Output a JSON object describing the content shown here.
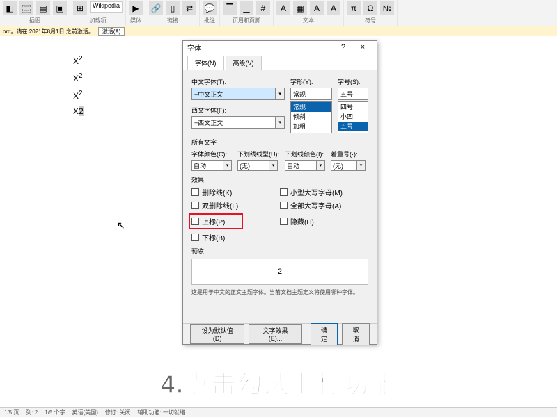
{
  "ribbon": {
    "groups": [
      {
        "label": "插图",
        "icons": [
          "3D 模",
          "SmartArt",
          "图表",
          "屏幕截图"
        ]
      },
      {
        "label": "加载项",
        "icons": [
          "获取加载项",
          "我的加载项",
          "Wikipedia"
        ]
      },
      {
        "label": "媒体",
        "icons": [
          "联机视频"
        ]
      },
      {
        "label": "链接",
        "icons": [
          "链接",
          "书签",
          "交叉引用"
        ]
      },
      {
        "label": "批注",
        "icons": [
          "批注"
        ]
      },
      {
        "label": "页眉和页脚",
        "icons": [
          "页眉",
          "页脚",
          "页码"
        ]
      },
      {
        "label": "文本",
        "icons": [
          "文本框",
          "文档部件",
          "艺术字",
          "首字下沉",
          "日期和时间",
          "对象"
        ]
      },
      {
        "label": "符号",
        "icons": [
          "公式",
          "符号",
          "编号"
        ]
      }
    ]
  },
  "messagebar": {
    "text": "ord。请在 2021年8月1日 之前激活。",
    "button": "激活(A)"
  },
  "document": {
    "lines": [
      "X²",
      "X²",
      "X²",
      "X"
    ],
    "selected_char": "2"
  },
  "dialog": {
    "title": "字体",
    "help": "?",
    "close": "×",
    "tabs": [
      "字体(N)",
      "高级(V)"
    ],
    "chinese_font": {
      "label": "中文字体(T):",
      "value": "+中文正文"
    },
    "western_font": {
      "label": "西文字体(F):",
      "value": "+西文正文"
    },
    "style": {
      "label": "字形(Y):",
      "value": "常规",
      "options": [
        "常规",
        "倾斜",
        "加粗"
      ]
    },
    "size": {
      "label": "字号(S):",
      "value": "五号",
      "options": [
        "四号",
        "小四",
        "五号"
      ]
    },
    "all_text": "所有文字",
    "font_color": {
      "label": "字体颜色(C):",
      "value": "自动"
    },
    "underline": {
      "label": "下划线线型(U):",
      "value": "(无)"
    },
    "underline_color": {
      "label": "下划线颜色(I):",
      "value": "自动"
    },
    "emphasis": {
      "label": "着重号(·):",
      "value": "(无)"
    },
    "effects_label": "效果",
    "effects": {
      "strikethrough": "删除线(K)",
      "double_strike": "双删除线(L)",
      "superscript": "上标(P)",
      "subscript": "下标(B)",
      "smallcaps": "小型大写字母(M)",
      "allcaps": "全部大写字母(A)",
      "hidden": "隐藏(H)"
    },
    "preview": {
      "label": "预览",
      "sample": "2"
    },
    "hint": "这是用于中文的正文主题字体。当前文档主题定义将使用哪种字体。",
    "footer": {
      "default": "设为默认值(D)",
      "text_effects": "文字效果(E)...",
      "ok": "确定",
      "cancel": "取消"
    }
  },
  "caption": "4.点击勾选上标功能",
  "status": {
    "page": "1/5 页",
    "col": "列: 2",
    "chars": "1/5 个字",
    "lang": "英语(美国)",
    "track": "修订: 关闭",
    "a11y": "辅助功能: 一切就绪"
  }
}
